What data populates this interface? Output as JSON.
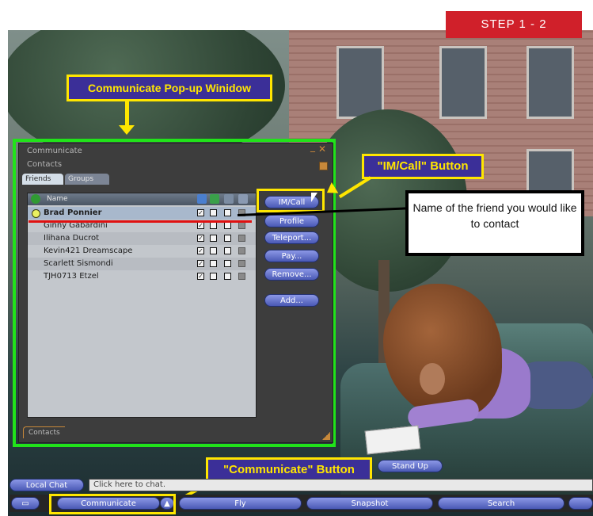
{
  "step_badge": "STEP 1 - 2",
  "annotations": {
    "popup_label": "Communicate Pop-up Winidow",
    "im_call_label": "\"IM/Call\" Button",
    "communicate_label": "\"Communicate\" Button",
    "callout_text": "Name of the friend you would like to contact"
  },
  "panel": {
    "title": "Communicate",
    "subtitle": "Contacts",
    "tabs": [
      "Friends",
      "Groups"
    ],
    "column_name": "Name",
    "footer_tab": "Contacts"
  },
  "friends": [
    {
      "name": "Brad Ponnier",
      "online": true,
      "selected": true
    },
    {
      "name": "Ginny Gabardini",
      "online": false,
      "selected": false
    },
    {
      "name": "Ilihana Ducrot",
      "online": false,
      "selected": false
    },
    {
      "name": "Kevin421 Dreamscape",
      "online": false,
      "selected": false
    },
    {
      "name": "Scarlett Sismondi",
      "online": false,
      "selected": false
    },
    {
      "name": "TJH0713 Etzel",
      "online": false,
      "selected": false
    }
  ],
  "buttons": {
    "im_call": "IM/Call",
    "profile": "Profile",
    "teleport": "Teleport...",
    "pay": "Pay...",
    "remove": "Remove...",
    "add": "Add..."
  },
  "stand_up": "Stand Up",
  "chat": {
    "local_chat": "Local Chat",
    "placeholder": "Click here to chat."
  },
  "toolbar": {
    "communicate": "Communicate",
    "fly": "Fly",
    "snapshot": "Snapshot",
    "search": "Search"
  }
}
